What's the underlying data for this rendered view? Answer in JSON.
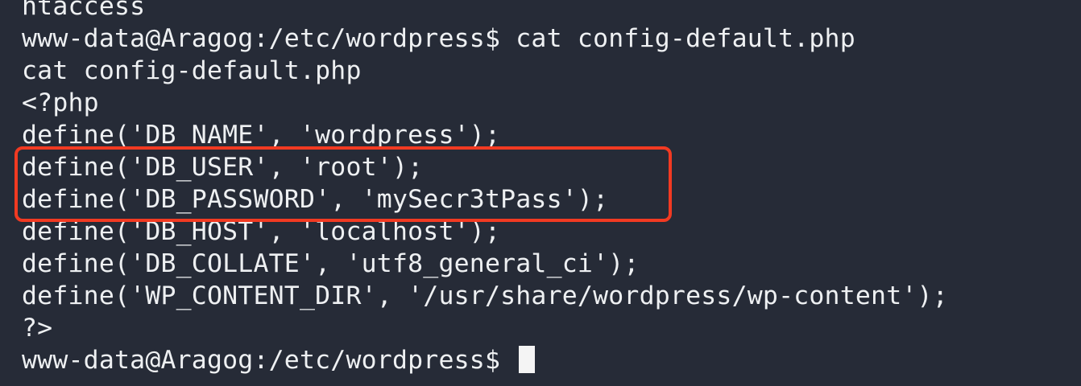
{
  "terminal": {
    "lines": [
      "htaccess",
      "www-data@Aragog:/etc/wordpress$ cat config-default.php",
      "cat config-default.php",
      "<?php",
      "define('DB_NAME', 'wordpress');",
      "define('DB_USER', 'root');",
      "define('DB_PASSWORD', 'mySecr3tPass');",
      "define('DB_HOST', 'localhost');",
      "define('DB_COLLATE', 'utf8_general_ci');",
      "define('WP_CONTENT_DIR', '/usr/share/wordpress/wp-content');",
      "?>"
    ],
    "prompt": "www-data@Aragog:/etc/wordpress$ ",
    "highlight_color": "#f23a22",
    "background_color": "#262b37",
    "text_color": "#eef0f2"
  }
}
